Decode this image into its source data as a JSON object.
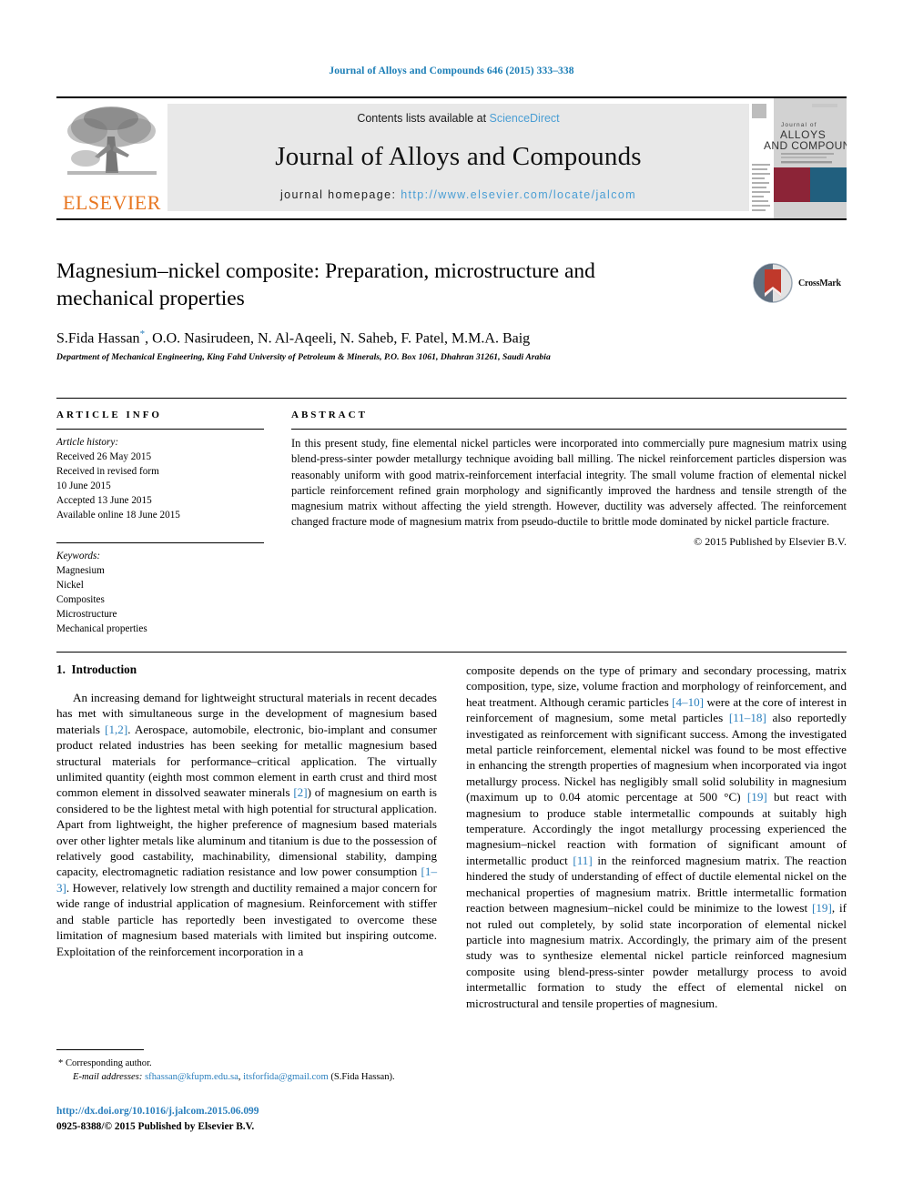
{
  "running_head": "Journal of Alloys and Compounds 646 (2015) 333–338",
  "masthead": {
    "publisher_logo_text": "ELSEVIER",
    "contents_prefix": "Contents lists available at ",
    "contents_link": "ScienceDirect",
    "journal_title": "Journal of Alloys and Compounds",
    "homepage_prefix": "journal homepage: ",
    "homepage_url": "http://www.elsevier.com/locate/jalcom",
    "cover": {
      "line1": "Journal of",
      "line2": "ALLOYS",
      "line3": "AND COMPOUNDS"
    }
  },
  "article": {
    "title": "Magnesium–nickel composite: Preparation, microstructure and mechanical properties",
    "authors": "S.Fida Hassan",
    "authors_rest": ", O.O. Nasirudeen, N. Al-Aqeeli, N. Saheb, F. Patel, M.M.A. Baig",
    "corresponding_marker": "*",
    "affiliation": "Department of Mechanical Engineering, King Fahd University of Petroleum & Minerals, P.O. Box 1061, Dhahran 31261, Saudi Arabia",
    "crossmark_label": "CrossMark"
  },
  "article_info": {
    "heading": "ARTICLE INFO",
    "history_label": "Article history:",
    "history": [
      "Received 26 May 2015",
      "Received in revised form",
      "10 June 2015",
      "Accepted 13 June 2015",
      "Available online 18 June 2015"
    ],
    "keywords_label": "Keywords:",
    "keywords": [
      "Magnesium",
      "Nickel",
      "Composites",
      "Microstructure",
      "Mechanical properties"
    ]
  },
  "abstract": {
    "heading": "ABSTRACT",
    "text": "In this present study, fine elemental nickel particles were incorporated into commercially pure magnesium matrix using blend-press-sinter powder metallurgy technique avoiding ball milling. The nickel reinforcement particles dispersion was reasonably uniform with good matrix-reinforcement interfacial integrity. The small volume fraction of elemental nickel particle reinforcement refined grain morphology and significantly improved the hardness and tensile strength of the magnesium matrix without affecting the yield strength. However, ductility was adversely affected. The reinforcement changed fracture mode of magnesium matrix from pseudo-ductile to brittle mode dominated by nickel particle fracture.",
    "copyright": "© 2015 Published by Elsevier B.V."
  },
  "introduction": {
    "section_number": "1.",
    "section_title": "Introduction",
    "left_para_1": "An increasing demand for lightweight structural materials in recent decades has met with simultaneous surge in the development of magnesium based materials ",
    "left_ref_1": "[1,2]",
    "left_para_2": ". Aerospace, automobile, electronic, bio-implant and consumer product related industries has been seeking for metallic magnesium based structural materials for performance–critical application. The virtually unlimited quantity (eighth most common element in earth crust and third most common element in dissolved seawater minerals ",
    "left_ref_2": "[2]",
    "left_para_3": ") of magnesium on earth is considered to be the lightest metal with high potential for structural application. Apart from lightweight, the higher preference of magnesium based materials over other lighter metals like aluminum and titanium is due to the possession of relatively good castability, machinability, dimensional stability, damping capacity, electromagnetic radiation resistance and low power consumption ",
    "left_ref_3": "[1–3]",
    "left_para_4": ". However, relatively low strength and ductility remained a major concern for wide range of industrial application of magnesium. Reinforcement with stiffer and stable particle has reportedly been investigated to overcome these limitation of magnesium based materials with limited but inspiring outcome. Exploitation of the reinforcement incorporation in a ",
    "right_para_1": "composite depends on the type of primary and secondary processing, matrix composition, type, size, volume fraction and morphology of reinforcement, and heat treatment. Although ceramic particles ",
    "right_ref_1": "[4–10]",
    "right_para_2": " were at the core of interest in reinforcement of magnesium, some metal particles ",
    "right_ref_2": "[11–18]",
    "right_para_3": " also reportedly investigated as reinforcement with significant success. Among the investigated metal particle reinforcement, elemental nickel was found to be most effective in enhancing the strength properties of magnesium when incorporated via ingot metallurgy process. Nickel has negligibly small solid solubility in magnesium (maximum up to 0.04 atomic percentage at 500 °C) ",
    "right_ref_3": "[19]",
    "right_para_4": " but react with magnesium to produce stable intermetallic compounds at suitably high temperature. Accordingly the ingot metallurgy processing experienced the magnesium–nickel reaction with formation of significant amount of intermetallic product ",
    "right_ref_4": "[11]",
    "right_para_5": " in the reinforced magnesium matrix. The reaction hindered the study of understanding of effect of ductile elemental nickel on the mechanical properties of magnesium matrix. Brittle intermetallic formation reaction between magnesium–nickel could be minimize to the lowest ",
    "right_ref_5": "[19]",
    "right_para_6": ", if not ruled out completely, by solid state incorporation of elemental nickel particle into magnesium matrix. Accordingly, the primary aim of the present study was to synthesize elemental nickel particle reinforced magnesium composite using blend-press-sinter powder metallurgy process to avoid intermetallic formation to study the effect of elemental nickel on microstructural and tensile properties of magnesium."
  },
  "footnote": {
    "corresponding": "Corresponding author.",
    "email_label": "E-mail addresses:",
    "email_1": "sfhassan@kfupm.edu.sa",
    "email_sep": ", ",
    "email_2": "itsforfida@gmail.com",
    "email_suffix": " (S.Fida Hassan)."
  },
  "footer": {
    "doi": "http://dx.doi.org/10.1016/j.jalcom.2015.06.099",
    "issn_line": "0925-8388/© 2015 Published by Elsevier B.V."
  },
  "colors": {
    "link_blue": "#2a7fbd",
    "sd_blue": "#4a9ed4",
    "elsevier_orange": "#E87722",
    "band_gray": "#e8e8e8",
    "cover_maroon": "#8c2437",
    "cover_teal": "#215f7e"
  }
}
